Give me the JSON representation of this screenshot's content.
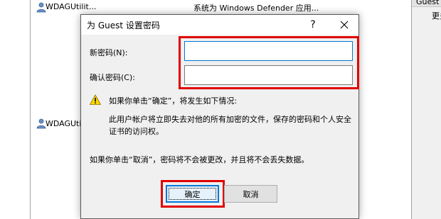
{
  "background": {
    "user_name": "WDAGUtilit...",
    "user_desc": "系统为 Windows Defender 应用...",
    "user2_name": "WDAGUtilit...",
    "right_pane": {
      "header": "Guest",
      "item": "更多"
    }
  },
  "dialog": {
    "title": "为 Guest 设置密码",
    "help_glyph": "?",
    "new_password_label": "新密码(N):",
    "confirm_password_label": "确认密码(C):",
    "new_password_value": "",
    "confirm_password_value": "",
    "warning_title": "如果你单击“确定”，将发生如下情况:",
    "warning_body": "此用户帐户将立即失去对他的所有加密的文件，保存的密码和个人安全证书的访问权。",
    "cancel_note": "如果你单击“取消”，密码将不会被更改，并且将不会丢失数据。",
    "ok_label": "确定",
    "cancel_label": "取消"
  },
  "colors": {
    "highlight_red": "#e00000",
    "focus_blue": "#0078d7",
    "dialog_bg": "#f0f0f0",
    "warning_yellow": "#ffd800"
  },
  "icons": {
    "user": "user-icon",
    "warning": "warning-icon",
    "close": "close-icon",
    "help": "help-icon"
  }
}
